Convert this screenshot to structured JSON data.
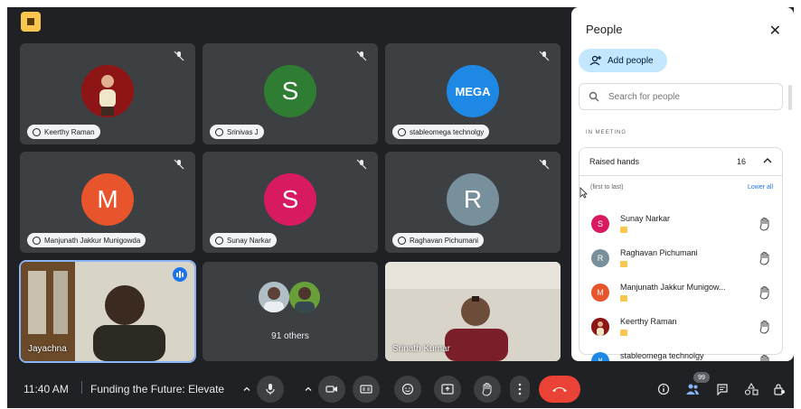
{
  "tiles": [
    {
      "name": "Keerthy Raman",
      "kind": "photo"
    },
    {
      "name": "Srinivas J",
      "initial": "S",
      "color": "#2e7d32"
    },
    {
      "name": "stableomega technolgy",
      "kind": "logo",
      "logo_text": "MEGA"
    },
    {
      "name": "Manjunath Jakkur Munigowda",
      "initial": "M",
      "color": "#e8552d"
    },
    {
      "name": "Sunay Narkar",
      "initial": "S",
      "color": "#d81b60"
    },
    {
      "name": "Raghavan Pichumani",
      "initial": "R",
      "color": "#78909c"
    },
    {
      "name": "Jayachna",
      "kind": "video"
    },
    {
      "others_label": "91 others"
    },
    {
      "name": "Srinath Kumar",
      "kind": "video"
    }
  ],
  "bottombar": {
    "time": "11:40 AM",
    "meeting_title": "Funding the Future: Elevate ...",
    "people_count": "99"
  },
  "panel": {
    "title": "People",
    "add_people": "Add people",
    "search_placeholder": "Search for people",
    "section": "IN MEETING",
    "raised_hands_label": "Raised hands",
    "raised_hands_count": "16",
    "order_label": "(first to last)",
    "lower_all": "Lower all",
    "people": [
      {
        "name": "Sunay Narkar",
        "initial": "S",
        "color": "#d81b60"
      },
      {
        "name": "Raghavan Pichumani",
        "initial": "R",
        "color": "#78909c"
      },
      {
        "name": "Manjunath Jakkur Munigow...",
        "initial": "M",
        "color": "#e8552d"
      },
      {
        "name": "Keerthy Raman",
        "initial": "",
        "color": "#6d4c41"
      },
      {
        "name": "stableomega technolgy",
        "initial": "M",
        "color": "#1e88e5"
      }
    ]
  },
  "colors": {
    "accent": "#1a73e8",
    "end_call": "#ea4335",
    "raise_flag": "#f9c74f"
  }
}
